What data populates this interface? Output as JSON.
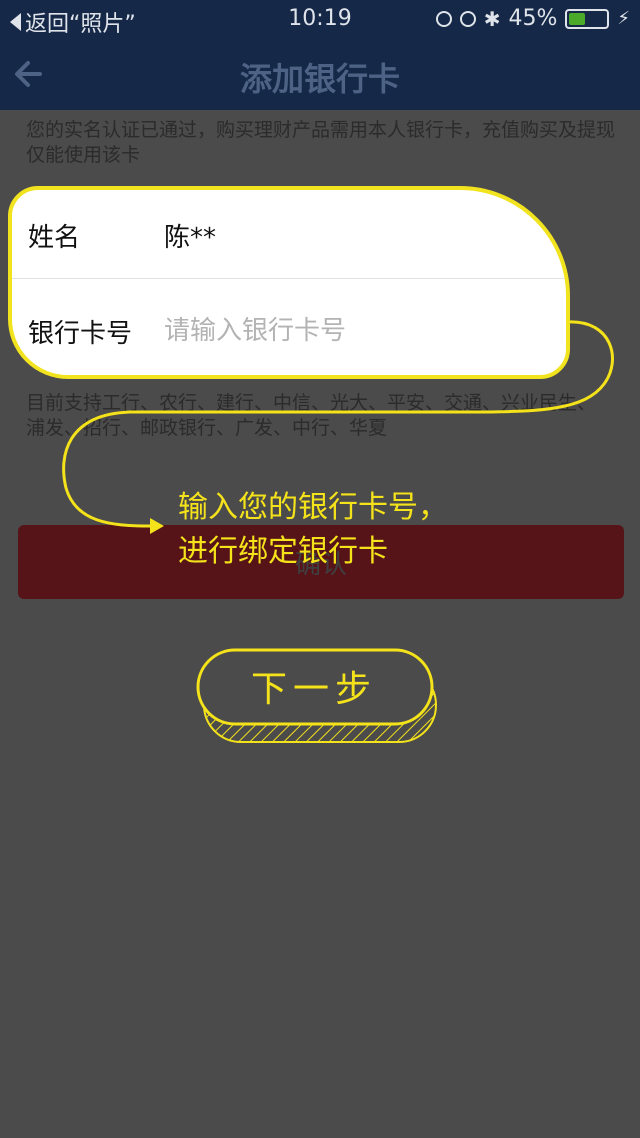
{
  "status_bar": {
    "back_app": "返回“照片”",
    "time": "10:19",
    "battery": "45%"
  },
  "nav": {
    "title": "添加银行卡"
  },
  "notice": "您的实名认证已通过，购买理财产品需用本人银行卡，充值购买及提现仅能使用该卡",
  "form": {
    "name_label": "姓名",
    "name_value": "陈**",
    "card_label": "银行卡号",
    "card_placeholder": "请输入银行卡号",
    "card_value": ""
  },
  "banks": "目前支持工行、农行、建行、中信、光大、平安、交通、兴业民生、浦发、招行、邮政银行、广发、中行、华夏",
  "confirm_button": "确认",
  "hint": {
    "line1": "输入您的银行卡号，",
    "line2": "进行绑定银行卡"
  },
  "next_step_button": "下一步",
  "colors": {
    "nav_bg": "#152848",
    "overlay": "#4b4b4b",
    "highlight": "#f4e21a",
    "confirm_bg": "#561419"
  }
}
